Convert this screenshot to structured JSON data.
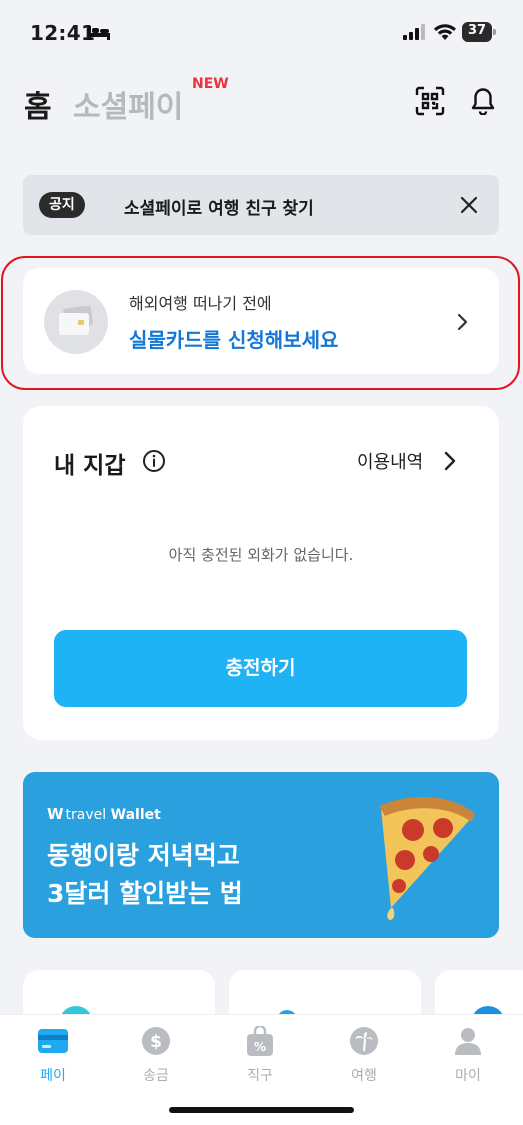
{
  "status_bar": {
    "time": "12:41",
    "battery": "37"
  },
  "header": {
    "home_tab": "홈",
    "social_tab": "소셜페이",
    "new_badge": "NEW",
    "icons": [
      "qr-scan-icon",
      "bell-icon"
    ]
  },
  "notice": {
    "badge": "공지",
    "text": "소셜페이로 여행 친구 찾기"
  },
  "card_promo": {
    "line1": "해외여행 떠나기 전에",
    "line2": "실물카드를 신청해보세요"
  },
  "wallet": {
    "title": "내 지갑",
    "history_label": "이용내역",
    "empty_message": "아직 충전된 외화가 없습니다.",
    "charge_button": "충전하기"
  },
  "banner": {
    "brand_light": "travel",
    "brand_bold": "Wallet",
    "line1": "동행이랑 저녁먹고",
    "line2": "3달러 할인받는 법"
  },
  "tabbar": {
    "items": [
      {
        "label": "페이",
        "icon": "card-icon",
        "active": true
      },
      {
        "label": "송금",
        "icon": "dollar-coin-icon",
        "active": false
      },
      {
        "label": "직구",
        "icon": "shopping-bag-percent-icon",
        "active": false
      },
      {
        "label": "여행",
        "icon": "palm-tree-icon",
        "active": false
      },
      {
        "label": "마이",
        "icon": "person-icon",
        "active": false
      }
    ]
  },
  "colors": {
    "accent": "#1fb2f5",
    "link_blue": "#1377d8",
    "banner_bg": "#2aa0df",
    "new_red": "#f0303a",
    "highlight_red": "#e5141f"
  }
}
